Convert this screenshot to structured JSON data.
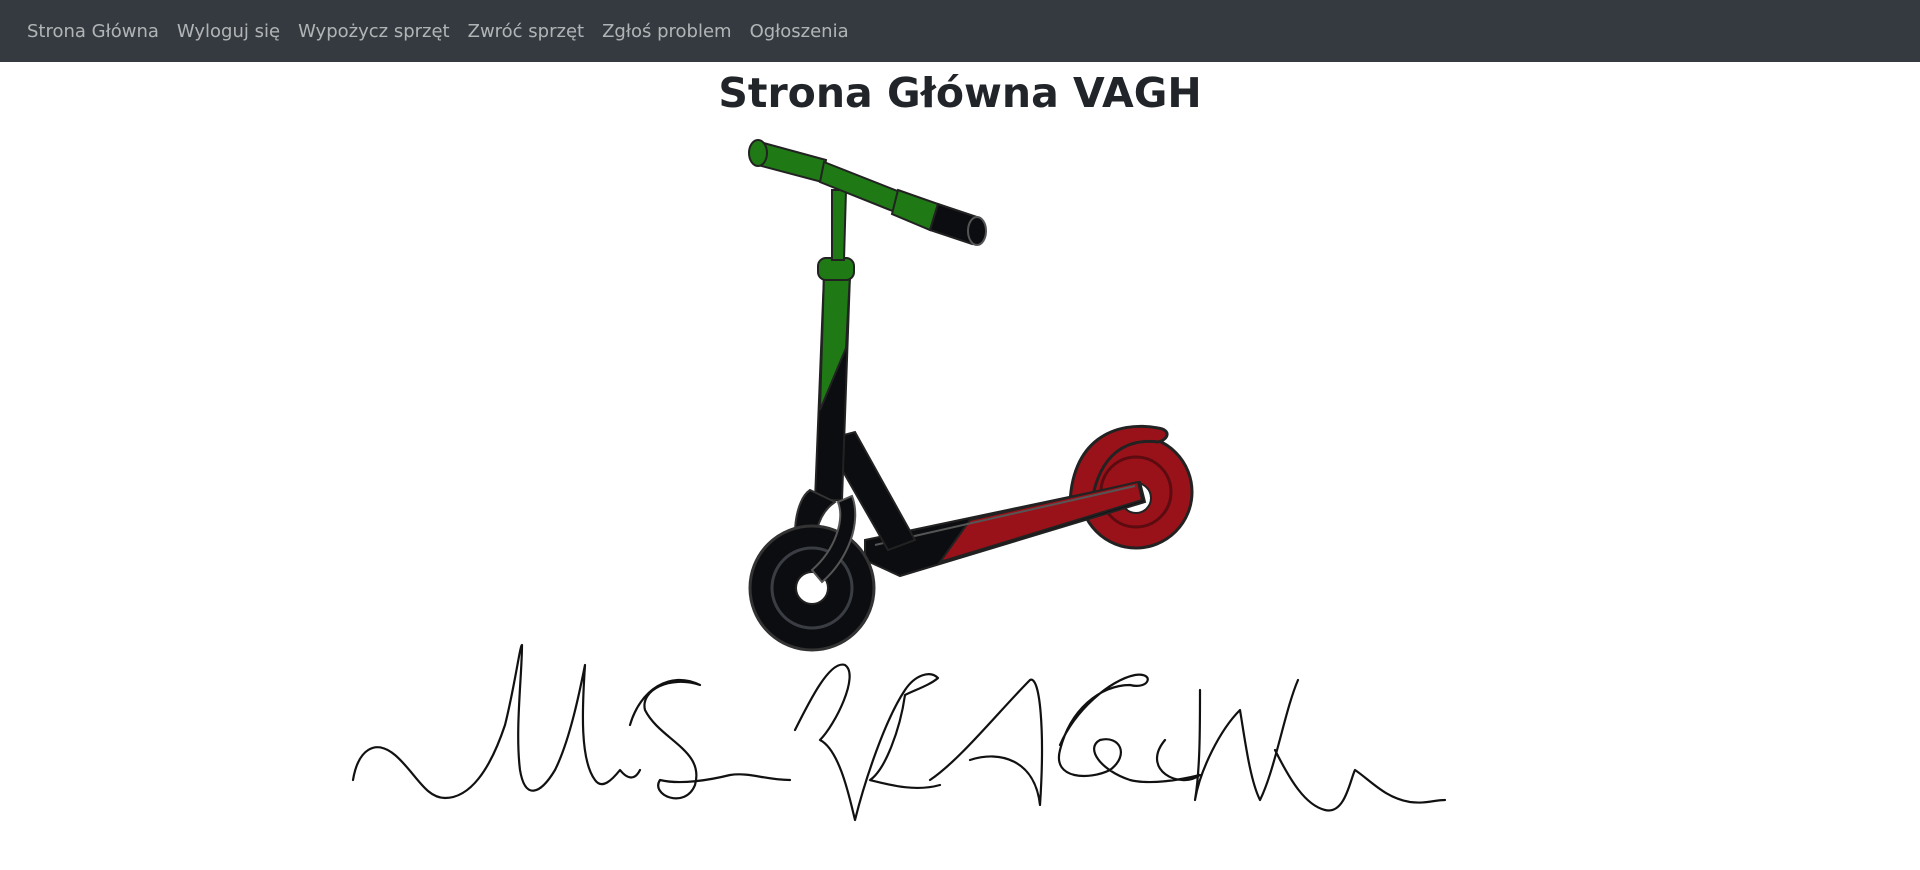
{
  "nav": {
    "items": [
      {
        "label": "Strona Główna"
      },
      {
        "label": "Wyloguj się"
      },
      {
        "label": "Wypożycz sprzęt"
      },
      {
        "label": "Zwróć sprzęt"
      },
      {
        "label": "Zgłoś problem"
      },
      {
        "label": "Ogłoszenia"
      }
    ]
  },
  "page": {
    "title": "Strona Główna VAGH"
  },
  "colors": {
    "navbar_bg": "#343a40",
    "scooter_green": "#1f7a16",
    "scooter_red": "#9a1219",
    "scooter_black": "#0c0d10"
  },
  "images": {
    "scooter": {
      "icon": "kick-scooter-illustration"
    },
    "signature": {
      "icon": "handwritten-signature",
      "text": "VAGH"
    }
  }
}
